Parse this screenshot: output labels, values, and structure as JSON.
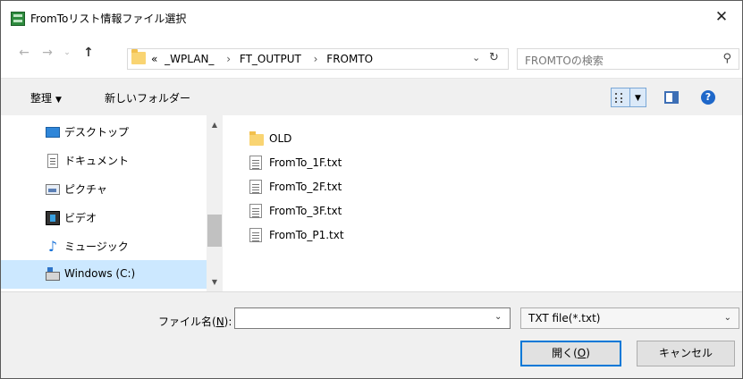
{
  "window": {
    "title": "FromToリスト情報ファイル選択",
    "close_glyph": "✕"
  },
  "nav": {
    "back": "←",
    "forward": "→",
    "recent": "⌄",
    "up": "↑"
  },
  "address": {
    "overflow": "«",
    "crumbs": [
      "_WPLAN_",
      "FT_OUTPUT",
      "FROMTO"
    ],
    "separator": "›",
    "dropdown_glyph": "⌄",
    "refresh_glyph": "↻"
  },
  "search": {
    "placeholder": "FROMTOの検索",
    "icon_glyph": "⚲"
  },
  "toolbar": {
    "organize_label": "整理",
    "organize_caret": "▼",
    "new_folder_label": "新しいフォルダー",
    "view_dd_glyph": "▼",
    "help_glyph": "?"
  },
  "sidebar": {
    "items": [
      {
        "label": "デスクトップ",
        "icon": "desktop-icon"
      },
      {
        "label": "ドキュメント",
        "icon": "documents-icon"
      },
      {
        "label": "ピクチャ",
        "icon": "pictures-icon"
      },
      {
        "label": "ビデオ",
        "icon": "videos-icon"
      },
      {
        "label": "ミュージック",
        "icon": "music-icon",
        "glyph": "♪"
      },
      {
        "label": "Windows (C:)",
        "icon": "drive-icon",
        "selected": true
      }
    ],
    "scroll_up": "▲",
    "scroll_down": "▼"
  },
  "files": [
    {
      "name": "OLD",
      "type": "folder"
    },
    {
      "name": "FromTo_1F.txt",
      "type": "txt"
    },
    {
      "name": "FromTo_2F.txt",
      "type": "txt"
    },
    {
      "name": "FromTo_3F.txt",
      "type": "txt"
    },
    {
      "name": "FromTo_P1.txt",
      "type": "txt"
    }
  ],
  "footer": {
    "filename_label_pre": "ファイル名(",
    "filename_label_key": "N",
    "filename_label_post": "):",
    "filename_value": "",
    "filename_dd": "⌄",
    "filetype_value": "TXT file(*.txt)",
    "filetype_dd": "⌄",
    "open_label_pre": "開く(",
    "open_label_key": "O",
    "open_label_post": ")",
    "cancel_label": "キャンセル"
  }
}
